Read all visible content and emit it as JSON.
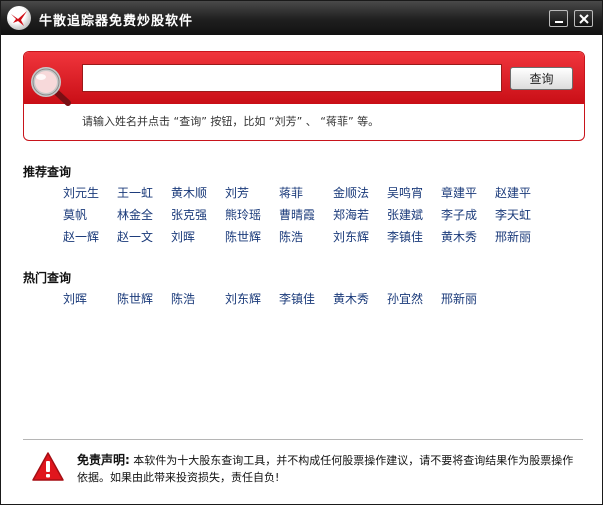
{
  "window": {
    "title": "牛散追踪器免费炒股软件",
    "icons": {
      "logo": "red-bird-logo",
      "minimize": "minimize-icon",
      "close": "close-icon"
    }
  },
  "search": {
    "value": "",
    "placeholder": "",
    "button_label": "查询",
    "hint": "请输入姓名并点击 “查询” 按钮，比如 “刘芳” 、 “蒋菲” 等。",
    "icon": "magnifier-icon"
  },
  "recommended": {
    "title": "推荐查询",
    "names": [
      "刘元生",
      "王一虹",
      "黄木顺",
      "刘芳",
      "蒋菲",
      "金顺法",
      "吴鸣宵",
      "章建平",
      "赵建平",
      "莫帆",
      "林金全",
      "张克强",
      "熊玲瑶",
      "曹晴霞",
      "郑海若",
      "张建斌",
      "李子成",
      "李天虹",
      "赵一辉",
      "赵一文",
      "刘晖",
      "陈世辉",
      "陈浩",
      "刘东辉",
      "李镇佳",
      "黄木秀",
      "邢新丽"
    ]
  },
  "popular": {
    "title": "热门查询",
    "names": [
      "刘晖",
      "陈世辉",
      "陈浩",
      "刘东辉",
      "李镇佳",
      "黄木秀",
      "孙宜然",
      "邢新丽"
    ]
  },
  "disclaimer": {
    "title": "免责声明:",
    "text": " 本软件为十大股东查询工具，并不构成任何股票操作建议，请不要将查询结果作为股票操作依据。如果由此带来投资损失，责任自负!",
    "icon": "warning-icon"
  },
  "colors": {
    "accent": "#d6141c",
    "link": "#1a3a7a",
    "titlebar": "#1f1f1f"
  }
}
